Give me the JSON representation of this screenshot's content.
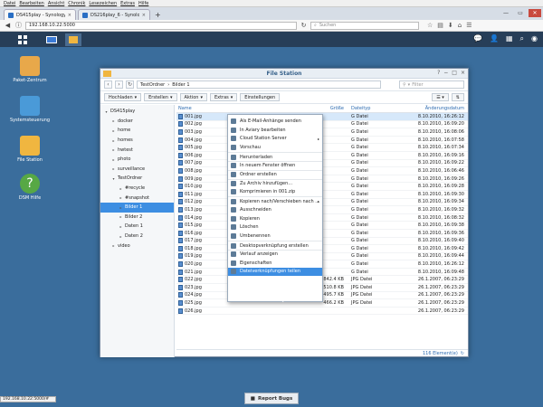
{
  "menubar": [
    "Datei",
    "Bearbeiten",
    "Ansicht",
    "Chronik",
    "Lesezeichen",
    "Extras",
    "Hilfe"
  ],
  "tabs": [
    {
      "label": "DS415play - Synology Disk...",
      "close": "×",
      "active": true
    },
    {
      "label": "DS216play_6 - Synology Di...",
      "close": "×",
      "active": false
    }
  ],
  "newtab": "+",
  "url": "192.168.10.22:5000",
  "search_placeholder": "Suchen",
  "window_controls": {
    "min": "—",
    "max": "▭",
    "close": "✕"
  },
  "desktop": [
    {
      "label": "Paket-Zentrum",
      "color": "#e8a84a"
    },
    {
      "label": "Systemsteuerung",
      "color": "#4a9ad8"
    },
    {
      "label": "File Station",
      "color": "#f0b640"
    },
    {
      "label": "DSM Hilfe",
      "color": "#57a845"
    }
  ],
  "fs": {
    "title": "File Station",
    "path": [
      "TestOrdner",
      "Bilder 1"
    ],
    "filter_placeholder": "Filter",
    "toolbar": [
      "Hochladen",
      "Erstellen",
      "Aktion",
      "Extras"
    ],
    "toolbar_plain": "Einstellungen",
    "tree": [
      {
        "label": "DS415play",
        "level": 0,
        "arrow": "▾"
      },
      {
        "label": "docker",
        "level": 1,
        "arrow": "▸"
      },
      {
        "label": "home",
        "level": 1,
        "arrow": "▸"
      },
      {
        "label": "homes",
        "level": 1,
        "arrow": "▸"
      },
      {
        "label": "hwtest",
        "level": 1,
        "arrow": "▸"
      },
      {
        "label": "photo",
        "level": 1,
        "arrow": "▸"
      },
      {
        "label": "surveillance",
        "level": 1,
        "arrow": "▸"
      },
      {
        "label": "TestOrdner",
        "level": 1,
        "arrow": "▾"
      },
      {
        "label": "#recycle",
        "level": 2,
        "arrow": "▸"
      },
      {
        "label": "#snapshot",
        "level": 2,
        "arrow": "▸"
      },
      {
        "label": "Bilder 1",
        "level": 2,
        "arrow": "▸",
        "selected": true
      },
      {
        "label": "Bilder 2",
        "level": 2,
        "arrow": "▸"
      },
      {
        "label": "Daten 1",
        "level": 2,
        "arrow": "▸"
      },
      {
        "label": "Daten 2",
        "level": 2,
        "arrow": "▸"
      },
      {
        "label": "video",
        "level": 1,
        "arrow": "▸"
      }
    ],
    "columns": {
      "name": "Name",
      "size": "Größe",
      "type": "Dateityp",
      "date": "Änderungsdatum"
    },
    "rows": [
      {
        "name": "001.jpg",
        "size": "",
        "type": "G Datei",
        "date": "8.10.2010, 16:26:12",
        "sel": true
      },
      {
        "name": "002.jpg",
        "size": "",
        "type": "G Datei",
        "date": "8.10.2010, 16:09:20"
      },
      {
        "name": "003.jpg",
        "size": "",
        "type": "G Datei",
        "date": "8.10.2010, 16:08:06"
      },
      {
        "name": "004.jpg",
        "size": "",
        "type": "G Datei",
        "date": "8.10.2010, 16:07:58"
      },
      {
        "name": "005.jpg",
        "size": "",
        "type": "G Datei",
        "date": "8.10.2010, 16:07:34"
      },
      {
        "name": "006.jpg",
        "size": "",
        "type": "G Datei",
        "date": "8.10.2010, 16:09:16"
      },
      {
        "name": "007.jpg",
        "size": "",
        "type": "G Datei",
        "date": "8.10.2010, 16:09:22"
      },
      {
        "name": "008.jpg",
        "size": "",
        "type": "G Datei",
        "date": "8.10.2010, 16:06:46"
      },
      {
        "name": "009.jpg",
        "size": "",
        "type": "G Datei",
        "date": "8.10.2010, 16:09:26"
      },
      {
        "name": "010.jpg",
        "size": "",
        "type": "G Datei",
        "date": "8.10.2010, 16:09:28"
      },
      {
        "name": "011.jpg",
        "size": "",
        "type": "G Datei",
        "date": "8.10.2010, 16:09:30"
      },
      {
        "name": "012.jpg",
        "size": "",
        "type": "G Datei",
        "date": "8.10.2010, 16:09:34"
      },
      {
        "name": "013.jpg",
        "size": "",
        "type": "G Datei",
        "date": "8.10.2010, 16:09:32"
      },
      {
        "name": "014.jpg",
        "size": "",
        "type": "G Datei",
        "date": "8.10.2010, 16:08:32"
      },
      {
        "name": "015.jpg",
        "size": "",
        "type": "G Datei",
        "date": "8.10.2010, 16:09:38"
      },
      {
        "name": "016.jpg",
        "size": "",
        "type": "G Datei",
        "date": "8.10.2010, 16:09:36"
      },
      {
        "name": "017.jpg",
        "size": "",
        "type": "G Datei",
        "date": "8.10.2010, 16:09:40"
      },
      {
        "name": "018.jpg",
        "size": "",
        "type": "G Datei",
        "date": "8.10.2010, 16:09:42"
      },
      {
        "name": "019.jpg",
        "size": "",
        "type": "G Datei",
        "date": "8.10.2010, 16:09:44"
      },
      {
        "name": "020.jpg",
        "size": "",
        "type": "G Datei",
        "date": "8.10.2010, 16:26:12"
      },
      {
        "name": "021.jpg",
        "size": "",
        "type": "G Datei",
        "date": "8.10.2010, 16:09:48"
      },
      {
        "name": "022.jpg",
        "size": "842.4 KB",
        "type": "JPG Datei",
        "date": "26.1.2007, 06:23:29"
      },
      {
        "name": "023.jpg",
        "size": "510.8 KB",
        "type": "JPG Datei",
        "date": "26.1.2007, 06:23:29"
      },
      {
        "name": "024.jpg",
        "size": "495.7 KB",
        "type": "JPG Datei",
        "date": "26.1.2007, 06:23:29"
      },
      {
        "name": "025.jpg",
        "size": "466.2 KB",
        "type": "JPG Datei",
        "date": "26.1.2007, 06:23:29"
      },
      {
        "name": "026.jpg",
        "size": "",
        "type": "",
        "date": "26.1.2007, 06:23:29"
      }
    ],
    "footer": "116 Element(e)"
  },
  "context_menu": [
    {
      "label": "Als E-Mail-Anhänge senden"
    },
    {
      "label": "In Aviary bearbeiten"
    },
    {
      "label": "Cloud Station Server",
      "sub": "▸"
    },
    {
      "label": "Vorschau"
    },
    {
      "label": "Herunterladen",
      "sep": true
    },
    {
      "label": "In neuem Fenster öffnen",
      "sep": true
    },
    {
      "label": "Ordner erstellen",
      "sep": true
    },
    {
      "label": "Zu Archiv hinzufügen...",
      "sep": true
    },
    {
      "label": "Komprimieren in 001.zip"
    },
    {
      "label": "Kopieren nach/Verschieben nach ...",
      "sep": true,
      "sub": "▸"
    },
    {
      "label": "Ausschneiden"
    },
    {
      "label": "Kopieren"
    },
    {
      "label": "Löschen"
    },
    {
      "label": "Umbenennen"
    },
    {
      "label": "Desktopverknüpfung erstellen",
      "sep": true
    },
    {
      "label": "Verlauf anzeigen",
      "sep": true
    },
    {
      "label": "Eigenschaften"
    },
    {
      "label": "Dateiverknüpfungen teilen",
      "highlight": true
    }
  ],
  "report_bugs": "Report Bugs",
  "status_url": "192.168.10.22:5000/#"
}
